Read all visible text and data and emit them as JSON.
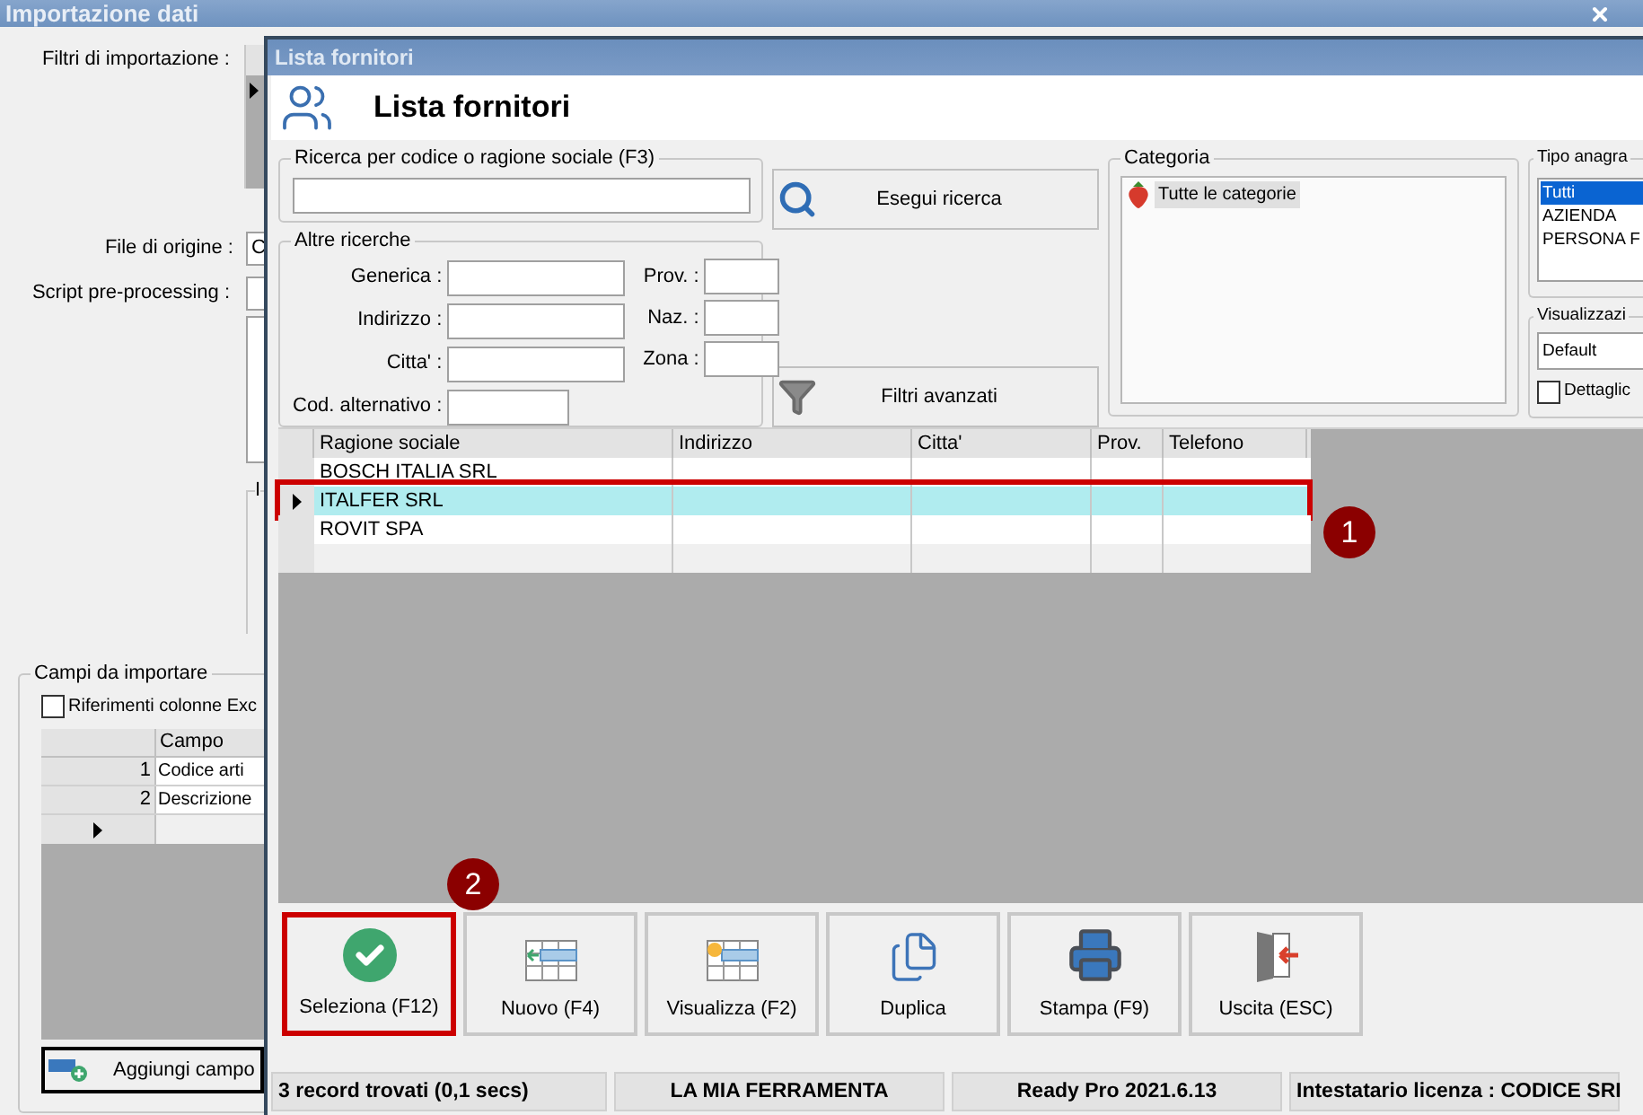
{
  "background_window": {
    "title": "Importazione dati",
    "import_filters_label": "Filtri di importazione :",
    "source_file_label": "File di origine :",
    "source_file_value": "C",
    "script_label": "Script pre-processing :",
    "group_label": "I",
    "fields_group": {
      "title": "Campi da importare",
      "excel_refs": {
        "label": "Riferimenti colonne Exc",
        "checked": false
      },
      "columns": [
        "Campo"
      ],
      "rows": [
        {
          "index": "1",
          "field": "Codice arti"
        },
        {
          "index": "2",
          "field": "Descrizione"
        }
      ],
      "add_button": "Aggiungi campo"
    }
  },
  "dialog": {
    "title": "Lista fornitori",
    "heading": "Lista fornitori",
    "search": {
      "legend": "Ricerca per codice o ragione sociale (F3)",
      "button": "Esegui ricerca"
    },
    "other_search": {
      "legend": "Altre ricerche",
      "left_fields": [
        {
          "label": "Generica :"
        },
        {
          "label": "Indirizzo :"
        },
        {
          "label": "Citta' :"
        },
        {
          "label": "Cod. alternativo :"
        }
      ],
      "right_fields": [
        {
          "label": "Prov. :"
        },
        {
          "label": "Naz. :"
        },
        {
          "label": "Zona :"
        }
      ]
    },
    "advanced_filters_button": "Filtri avanzati",
    "category": {
      "legend": "Categoria",
      "items": [
        {
          "label": "Tutte le categorie",
          "selected": true
        }
      ]
    },
    "registry_type": {
      "legend": "Tipo anagra",
      "items": [
        {
          "label": "Tutti",
          "selected": true
        },
        {
          "label": "AZIENDA",
          "selected": false
        },
        {
          "label": "PERSONA F",
          "selected": false
        }
      ]
    },
    "view": {
      "legend": "Visualizzazi",
      "value": "Default",
      "detail": {
        "label": "Dettaglic",
        "checked": false
      }
    },
    "table": {
      "columns": [
        "Ragione sociale",
        "Indirizzo",
        "Citta'",
        "Prov.",
        "Telefono"
      ],
      "rows": [
        {
          "name": "BOSCH ITALIA SRL",
          "selected": false,
          "callout": ""
        },
        {
          "name": "ITALFER SRL",
          "selected": true,
          "callout": "1"
        },
        {
          "name": "ROVIT SPA",
          "selected": false,
          "callout": ""
        }
      ]
    },
    "toolbar": [
      {
        "kind": "select",
        "label": "Seleziona (F12)",
        "callout": "2"
      },
      {
        "kind": "new",
        "label": "Nuovo (F4)"
      },
      {
        "kind": "view",
        "label": "Visualizza (F2)"
      },
      {
        "kind": "duplicate",
        "label": "Duplica"
      },
      {
        "kind": "print",
        "label": "Stampa (F9)"
      },
      {
        "kind": "exit",
        "label": "Uscita (ESC)"
      }
    ],
    "status_bar": [
      "3 record trovati (0,1 secs)",
      "LA MIA FERRAMENTA",
      "Ready Pro 2021.6.13",
      "Intestatario licenza : CODICE SRI"
    ]
  }
}
